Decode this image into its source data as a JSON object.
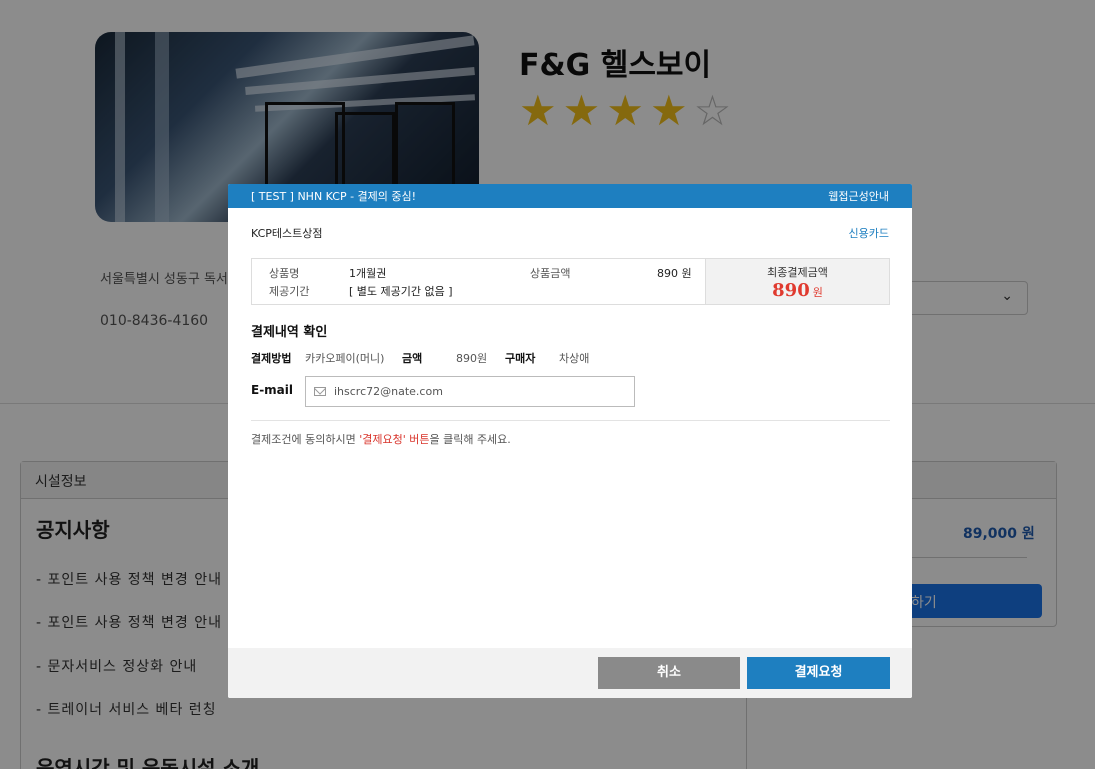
{
  "background": {
    "gym_name": "F&G 헬스보이",
    "rating_stars": 4,
    "rating_max": 5,
    "address": "서울특별시 성동구 독서",
    "phone": "010-8436-4160",
    "facility_tab": "시설정보",
    "notice_title": "공지사항",
    "notices": [
      "- 포인트 사용 정책 변경 안내",
      "- 포인트 사용 정책 변경 안내",
      "- 문자서비스 정상화 안내",
      "- 트레이너 서비스 베타 런칭"
    ],
    "ops_title": "운영시간 및 운동시설 소개",
    "price": "89,000 원",
    "buy_button_partial": "하기"
  },
  "modal": {
    "header_title": "[ TEST ] NHN KCP - 결제의 중심!",
    "header_help": "웹접근성안내",
    "merchant": "KCP테스트상점",
    "pay_type": "신용카드",
    "product_label": "상품명",
    "product_value": "1개월권",
    "period_label": "제공기간",
    "period_value": "[ 별도 제공기간 없음 ]",
    "price_label": "상품금액",
    "price_value": "890 원",
    "total_label": "최종결제금액",
    "total_amount": "890",
    "total_unit": "원",
    "section_title": "결제내역 확인",
    "method_label": "결제방법",
    "method_value": "카카오페이(머니)",
    "amount_label": "금액",
    "amount_value": "890원",
    "buyer_label": "구매자",
    "buyer_value": "차상애",
    "email_label": "E-mail",
    "email_value": "ihscrc72@nate.com",
    "agree_prefix": "결제조건에 동의하시면 ",
    "agree_highlight": "'결제요청' 버튼",
    "agree_suffix": "을 클릭해 주세요.",
    "cancel_label": "취소",
    "pay_label": "결제요청"
  },
  "colors": {
    "kcp_blue": "#1e7fc0",
    "total_red": "#e03a2f",
    "star_gold": "#f3c01b"
  }
}
